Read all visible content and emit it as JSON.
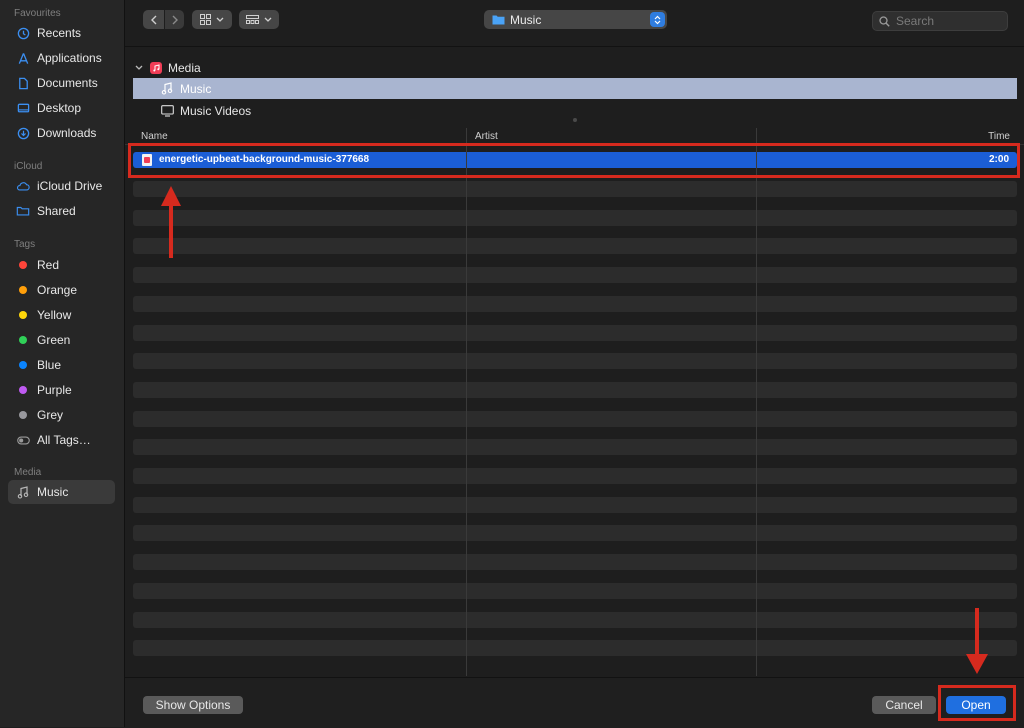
{
  "sidebar": {
    "favourites_title": "Favourites",
    "favourites": [
      {
        "label": "Recents",
        "icon": "clock-icon"
      },
      {
        "label": "Applications",
        "icon": "applications-icon"
      },
      {
        "label": "Documents",
        "icon": "document-icon"
      },
      {
        "label": "Desktop",
        "icon": "desktop-icon"
      },
      {
        "label": "Downloads",
        "icon": "download-icon"
      }
    ],
    "icloud_title": "iCloud",
    "icloud": [
      {
        "label": "iCloud Drive",
        "icon": "cloud-icon"
      },
      {
        "label": "Shared",
        "icon": "shared-folder-icon"
      }
    ],
    "tags_title": "Tags",
    "tags": [
      {
        "label": "Red",
        "color": "#ff453a"
      },
      {
        "label": "Orange",
        "color": "#ff9f0a"
      },
      {
        "label": "Yellow",
        "color": "#ffd60a"
      },
      {
        "label": "Green",
        "color": "#30d158"
      },
      {
        "label": "Blue",
        "color": "#0a84ff"
      },
      {
        "label": "Purple",
        "color": "#bf5af2"
      },
      {
        "label": "Grey",
        "color": "#98989d"
      },
      {
        "label": "All Tags…",
        "icon": "all-tags-icon"
      }
    ],
    "media_title": "Media",
    "media": [
      {
        "label": "Music",
        "icon": "music-note-icon",
        "active": true
      }
    ]
  },
  "toolbar": {
    "location": "Music",
    "search_placeholder": "Search"
  },
  "tree": {
    "root": "Media",
    "items": [
      {
        "label": "Music",
        "selected": true
      },
      {
        "label": "Music Videos",
        "selected": false
      }
    ]
  },
  "columns": {
    "name": "Name",
    "artist": "Artist",
    "time": "Time"
  },
  "files": [
    {
      "name": "energetic-upbeat-background-music-377668",
      "artist": "",
      "time": "2:00",
      "selected": true
    }
  ],
  "footer": {
    "show_options": "Show Options",
    "cancel": "Cancel",
    "open": "Open"
  },
  "colors": {
    "accent": "#1f6fe0",
    "highlight": "#d62a1e"
  }
}
